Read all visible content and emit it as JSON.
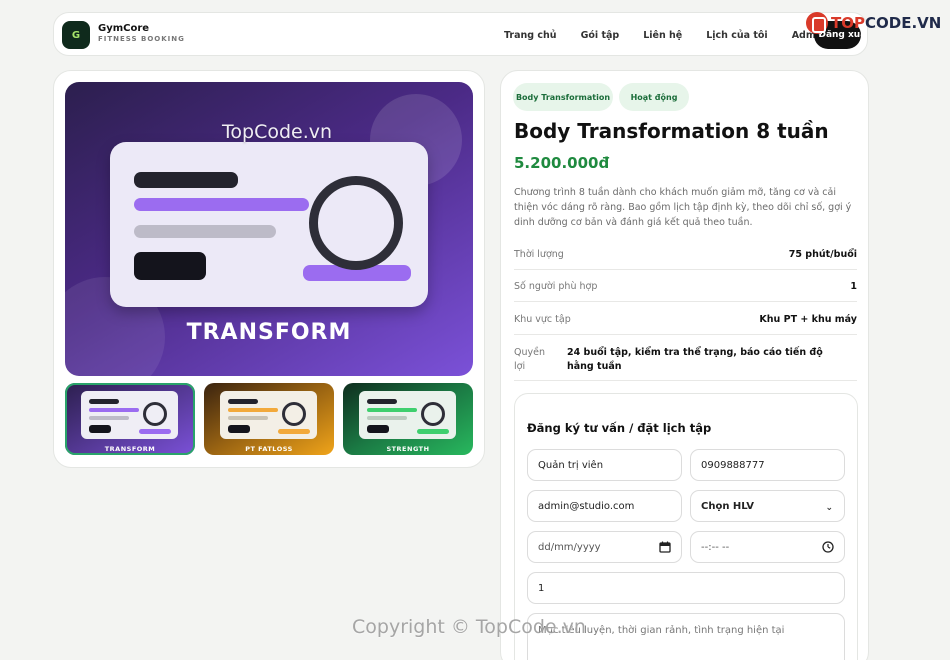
{
  "header": {
    "brand_initial": "G",
    "brand_name": "GymCore",
    "brand_sub": "FITNESS BOOKING",
    "nav": [
      "Trang chủ",
      "Gói tập",
      "Liên hệ",
      "Lịch của tôi",
      "Admin"
    ],
    "button_label": "Đăng xuất",
    "watermark_prefix": "TOP",
    "watermark_suffix": "CODE.VN"
  },
  "hero": {
    "watermark": "TopCode.vn",
    "caption": "TRANSFORM"
  },
  "thumbnails": [
    {
      "caption": "TRANSFORM",
      "accent": "#8b5cf6"
    },
    {
      "caption": "PT FATLOSS",
      "accent": "#f59e0b"
    },
    {
      "caption": "STRENGTH",
      "accent": "#22c55e"
    }
  ],
  "product": {
    "tags": [
      "Body Transformation",
      "Hoạt động"
    ],
    "title": "Body Transformation 8 tuần",
    "price": "5.200.000đ",
    "description": "Chương trình 8 tuần dành cho khách muốn giảm mỡ, tăng cơ và cải thiện vóc dáng rõ ràng. Bao gồm lịch tập định kỳ, theo dõi chỉ số, gợi ý dinh dưỡng cơ bản và đánh giá kết quả theo tuần.",
    "info": [
      {
        "label": "Thời lượng",
        "value": "75 phút/buổi"
      },
      {
        "label": "Số người phù hợp",
        "value": "1"
      },
      {
        "label": "Khu vực tập",
        "value": "Khu PT + khu máy"
      },
      {
        "label": "Quyền lợi",
        "value": "24 buổi tập, kiểm tra thể trạng, báo cáo tiến độ hằng tuần"
      }
    ]
  },
  "form": {
    "title": "Đăng ký tư vấn / đặt lịch tập",
    "name_value": "Quản trị viên",
    "phone_value": "0909888777",
    "email_value": "admin@studio.com",
    "trainer_value": "Chọn HLV",
    "date_placeholder": "dd/mm/yyyy",
    "time_placeholder": "--:-- --",
    "quantity_value": "1",
    "note_placeholder": "Mục tiêu luyện, thời gian rảnh, tình trạng hiện tại"
  },
  "footer": {
    "watermark": "Copyright © TopCode.vn"
  },
  "colors": {
    "accent_green": "#1f8a3f",
    "pill_bg": "#e7f5ea",
    "hero_purple": "#4b2a86"
  }
}
